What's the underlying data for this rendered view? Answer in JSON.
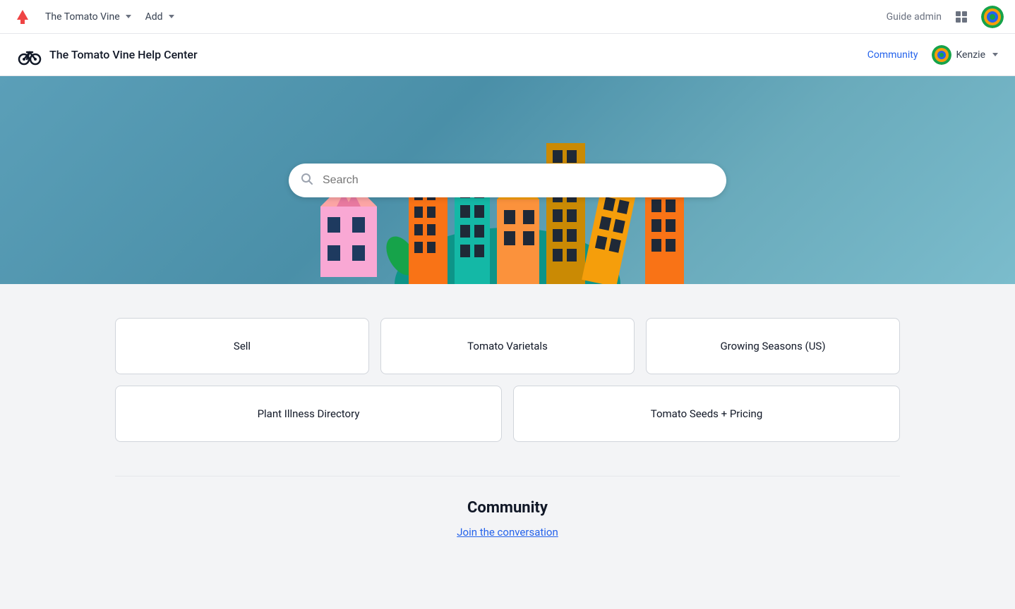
{
  "adminBar": {
    "brand": "The Tomato Vine",
    "brandChevron": "chevron-down",
    "add": "Add",
    "addChevron": "chevron-down",
    "guideAdmin": "Guide admin"
  },
  "helpHeader": {
    "title": "The Tomato Vine Help Center",
    "communityLink": "Community",
    "userName": "Kenzie",
    "userChevron": "chevron-down"
  },
  "search": {
    "placeholder": "Search"
  },
  "categories": {
    "row1": [
      {
        "label": "Sell"
      },
      {
        "label": "Tomato Varietals"
      },
      {
        "label": "Growing Seasons (US)"
      }
    ],
    "row2": [
      {
        "label": "Plant Illness Directory"
      },
      {
        "label": "Tomato Seeds + Pricing"
      }
    ]
  },
  "community": {
    "title": "Community",
    "joinLink": "Join the conversation"
  },
  "colors": {
    "accent": "#2563eb",
    "heroBg": "#5b9fb8"
  }
}
